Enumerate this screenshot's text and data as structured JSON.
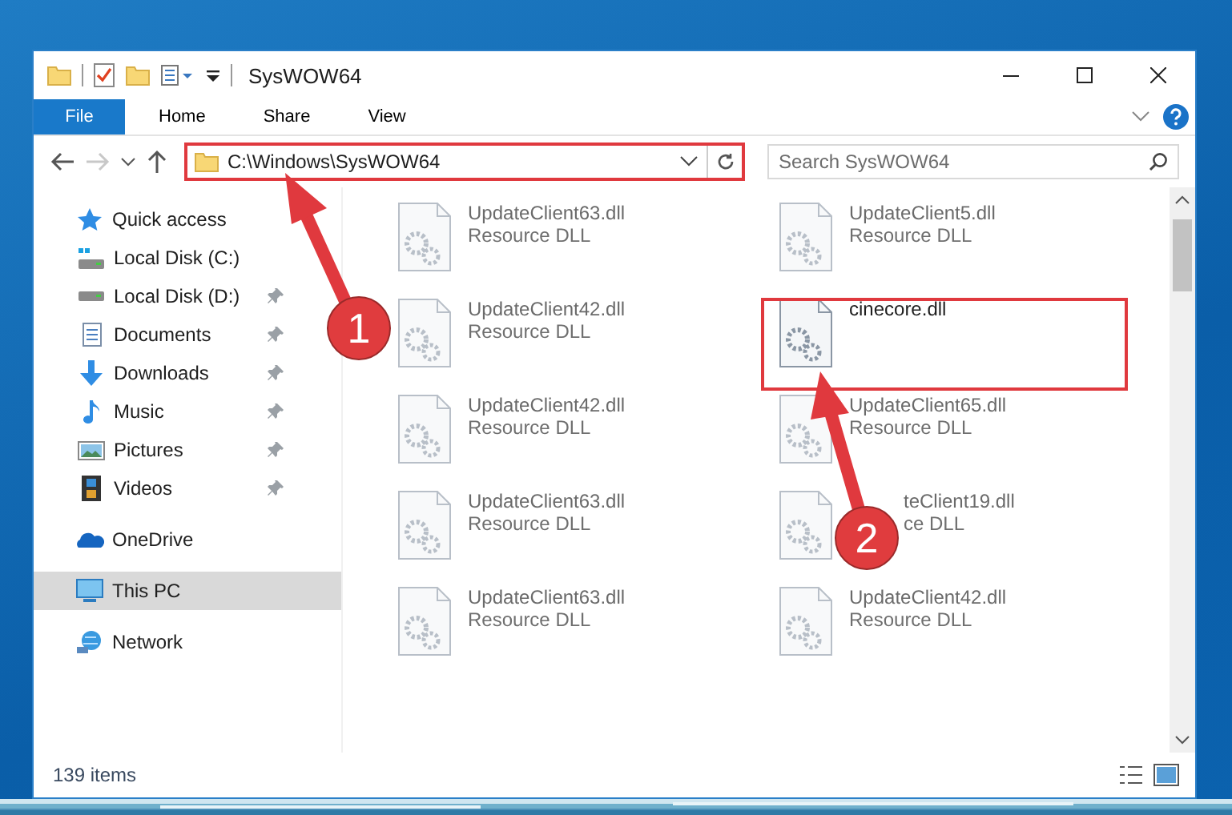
{
  "window": {
    "title": "SysWOW64"
  },
  "ribbon": {
    "file_tab": "File",
    "tabs": [
      {
        "label": "Home",
        "selected": false
      },
      {
        "label": "Share",
        "selected": false
      },
      {
        "label": "View",
        "selected": false
      }
    ]
  },
  "address": {
    "path": "C:\\Windows\\SysWOW64"
  },
  "search": {
    "placeholder": "Search SysWOW64"
  },
  "sidebar": {
    "items": [
      {
        "label": "Quick access",
        "selected": false,
        "pinned": false,
        "children": [
          {
            "label": "Local Disk (C:)",
            "selected": false,
            "pinned": false
          },
          {
            "label": "Local Disk (D:)",
            "selected": false,
            "pinned": true
          },
          {
            "label": "Documents",
            "selected": false,
            "pinned": true
          },
          {
            "label": "Downloads",
            "selected": false,
            "pinned": true
          },
          {
            "label": "Music",
            "selected": false,
            "pinned": true
          },
          {
            "label": "Pictures",
            "selected": false,
            "pinned": true
          },
          {
            "label": "Videos",
            "selected": false,
            "pinned": true
          }
        ]
      },
      {
        "label": "OneDrive",
        "selected": false,
        "pinned": false
      },
      {
        "label": "This PC",
        "selected": true,
        "pinned": false
      },
      {
        "label": "Network",
        "selected": false,
        "pinned": false
      }
    ]
  },
  "files": [
    {
      "name": "UpdateClient63.dll",
      "type": "Resource DLL",
      "blurred": true
    },
    {
      "name": "UpdateClient5.dll",
      "type": "Resource DLL",
      "blurred": true
    },
    {
      "name": "UpdateClient42.dll",
      "type": "Resource DLL",
      "blurred": true
    },
    {
      "name": "cinecore.dll",
      "blurred": false
    },
    {
      "name": "UpdateClient42.dll",
      "type": "Resource DLL",
      "blurred": true
    },
    {
      "name": "UpdateClient65.dll",
      "type": "Resource DLL",
      "blurred": true
    },
    {
      "name": "UpdateClient63.dll",
      "type": "Resource DLL",
      "blurred": true
    },
    {
      "name": "teClient19.dll",
      "type": "ce DLL",
      "blurred": true,
      "kind": "partly_covered"
    },
    {
      "name": "UpdateClient63.dll",
      "type": "Resource DLL",
      "blurred": true
    },
    {
      "name": "UpdateClient42.dll",
      "type": "Resource DLL",
      "blurred": true
    }
  ],
  "status_bar": {
    "item_count": "139 items"
  },
  "annotations": [
    {
      "number": "1"
    },
    {
      "number": "2"
    }
  ]
}
